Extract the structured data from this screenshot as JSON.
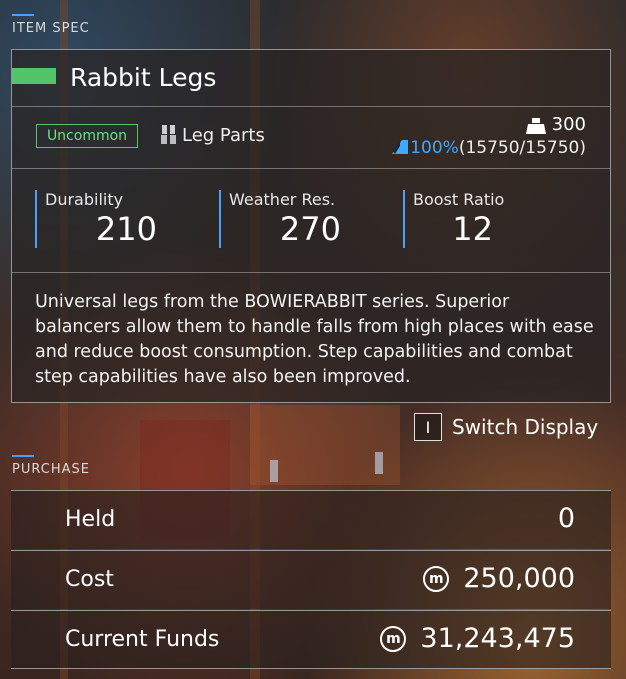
{
  "item_spec": {
    "section_label": "ITEM SPEC",
    "name": "Rabbit Legs",
    "rarity": "Uncommon",
    "rarity_color": "#54c46a",
    "part_icon": "leg-parts-icon",
    "part_type": "Leg Parts",
    "weight_icon": "weight-icon",
    "weight": "300",
    "ap_icon": "ap-shield-icon",
    "ap_percent": "100%",
    "ap_fraction": "(15750/15750)",
    "stats": [
      {
        "label": "Durability",
        "value": "210"
      },
      {
        "label": "Weather Res.",
        "value": "270"
      },
      {
        "label": "Boost Ratio",
        "value": "12"
      }
    ],
    "description": "Universal legs from the BOWIERABBIT series. Superior balancers allow them to handle falls from high places with ease and reduce boost consumption. Step capabilities and combat step capabilities have also been improved."
  },
  "switch_display": {
    "key": "I",
    "label": "Switch Display"
  },
  "purchase": {
    "section_label": "PURCHASE",
    "currency_icon": "coin-icon",
    "currency_symbol": "m",
    "held_label": "Held",
    "held_value": "0",
    "cost_label": "Cost",
    "cost_value": "250,000",
    "funds_label": "Current Funds",
    "funds_value": "31,243,475"
  },
  "accent_color": "#4aa0ff"
}
